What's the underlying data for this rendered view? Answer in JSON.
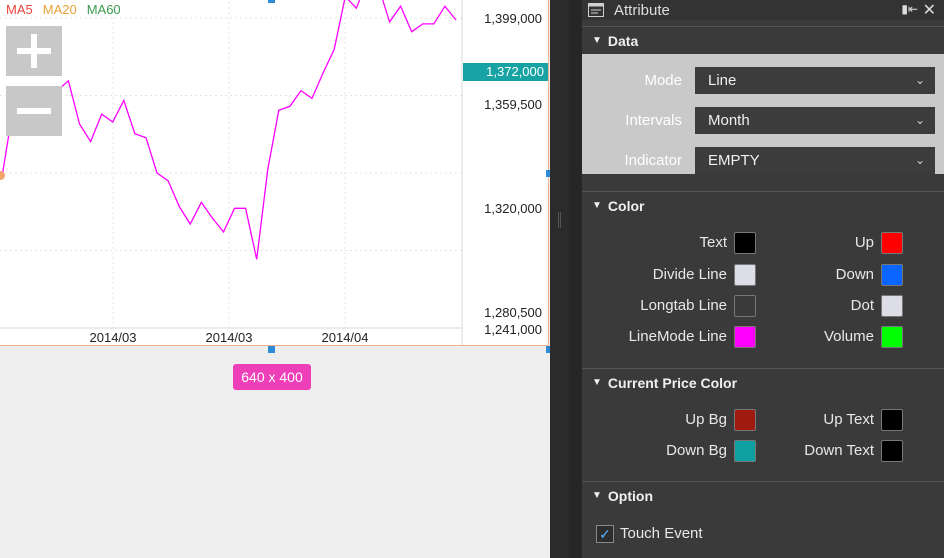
{
  "chart": {
    "legend": [
      {
        "label": "MA5",
        "color": "#e8453c"
      },
      {
        "label": "MA20",
        "color": "#e8a33c"
      },
      {
        "label": "MA60",
        "color": "#3a9a50"
      }
    ],
    "zoom_in_icon": "plus-icon",
    "zoom_out_icon": "minus-icon",
    "current_price": "1,372,000",
    "size_badge": "640 x 400",
    "line_color": "#ff00ff"
  },
  "chart_data": {
    "type": "line",
    "title": "",
    "xlabel": "",
    "ylabel": "",
    "x_ticks": [
      "2014/03",
      "2014/03",
      "2014/04"
    ],
    "y_ticks": [
      "1,399,000",
      "1,359,500",
      "1,320,000",
      "1,280,500",
      "1,241,000"
    ],
    "ylim": [
      1241000,
      1399000
    ],
    "series": [
      {
        "values": [
          1318000,
          1353000,
          1351000,
          1356000,
          1363000,
          1362000,
          1367000,
          1345000,
          1336000,
          1350000,
          1346000,
          1357000,
          1340000,
          1338000,
          1320000,
          1316000,
          1303000,
          1294000,
          1305000,
          1297000,
          1290000,
          1302000,
          1302000,
          1276000,
          1322000,
          1352000,
          1354000,
          1362000,
          1358000,
          1371000,
          1383000,
          1410000,
          1404000,
          1418000,
          1415000,
          1397000,
          1405000,
          1392000,
          1396000,
          1396000,
          1405000,
          1398000
        ]
      }
    ],
    "grid": true
  },
  "panel": {
    "title": "Attribute",
    "title_icon": "attribute-panel-icon",
    "pin_icon": "pin-icon",
    "close_icon": "close-icon",
    "data_section": {
      "title": "Data",
      "mode_label": "Mode",
      "mode_value": "Line",
      "intervals_label": "Intervals",
      "intervals_value": "Month",
      "indicator_label": "Indicator",
      "indicator_value": "EMPTY"
    },
    "color_section": {
      "title": "Color",
      "items": [
        {
          "label": "Text",
          "color": "#000000"
        },
        {
          "label": "Up",
          "color": "#ff0000"
        },
        {
          "label": "Divide Line",
          "color": "#dcdde6"
        },
        {
          "label": "Down",
          "color": "#0a66ff"
        },
        {
          "label": "Longtab Line",
          "color": "#3a3a3a"
        },
        {
          "label": "Dot",
          "color": "#dcdde6"
        },
        {
          "label": "LineMode Line",
          "color": "#ff00ff"
        },
        {
          "label": "Volume",
          "color": "#00ff00"
        }
      ]
    },
    "current_price_section": {
      "title": "Current Price Color",
      "items": [
        {
          "label": "Up Bg",
          "color": "#a01a10"
        },
        {
          "label": "Up Text",
          "color": "#000000"
        },
        {
          "label": "Down Bg",
          "color": "#0ea0a0"
        },
        {
          "label": "Down Text",
          "color": "#000000"
        }
      ]
    },
    "option_section": {
      "title": "Option",
      "touch_event_label": "Touch Event",
      "touch_event_checked": true
    }
  }
}
